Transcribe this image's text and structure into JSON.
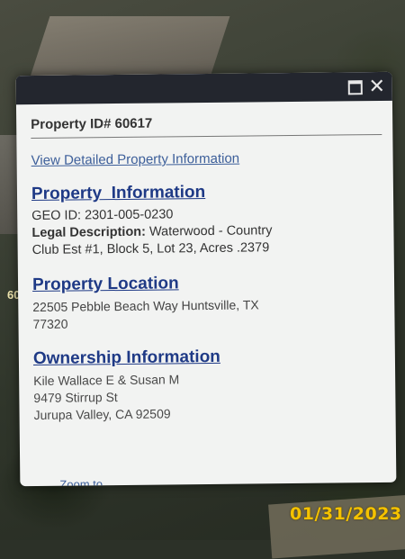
{
  "map": {
    "partial_label": "60"
  },
  "popup": {
    "property_id": "Property ID# 60617",
    "detail_link": "View Detailed Property Information",
    "property_info": {
      "heading": "Property  Information",
      "geo_id": "GEO ID: 2301-005-0230",
      "legal_label": "Legal Description:",
      "legal_value": " Waterwood - Country",
      "legal_cont": "Club Est #1, Block 5, Lot 23, Acres .2379"
    },
    "location": {
      "heading": "Property Location",
      "line1": "22505 Pebble Beach Way Huntsville, TX",
      "line2": "77320"
    },
    "ownership": {
      "heading": "Ownership Information",
      "line1": "Kile Wallace E & Susan M",
      "line2": "9479 Stirrup St",
      "line3": "Jurupa Valley, CA  92509"
    },
    "zoom_link": "Zoom to",
    "more": "…"
  },
  "date_stamp": "01/31/2023"
}
